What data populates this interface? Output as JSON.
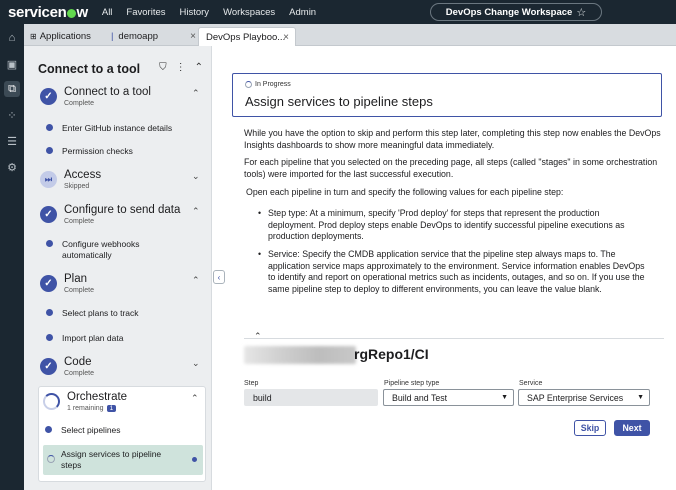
{
  "app": {
    "logo_text_1": "servicen",
    "logo_text_2": "w",
    "nav": [
      "All",
      "Favorites",
      "History",
      "Workspaces",
      "Admin"
    ],
    "workspace_title": "DevOps Change Workspace"
  },
  "tabs": {
    "applications": "Applications",
    "demoapp": "demoapp",
    "playbook": "DevOps Playboo..."
  },
  "sidebar": {
    "title": "Connect to a tool",
    "steps": [
      {
        "title": "Connect to a tool",
        "status": "Complete",
        "subs": [
          "Enter GitHub instance details",
          "Permission checks"
        ]
      },
      {
        "title": "Access",
        "status": "Skipped"
      },
      {
        "title": "Configure to send data",
        "status": "Complete",
        "subs": [
          "Configure webhooks automatically"
        ]
      },
      {
        "title": "Plan",
        "status": "Complete",
        "subs": [
          "Select plans to track",
          "Import plan data"
        ]
      },
      {
        "title": "Code",
        "status": "Complete"
      },
      {
        "title": "Orchestrate",
        "status": "1 remaining",
        "badge": "1",
        "subs": [
          "Select pipelines",
          "Assign services to pipeline steps"
        ]
      }
    ]
  },
  "main": {
    "status": "In Progress",
    "title": "Assign services to pipeline steps",
    "para1": "While you have the option to skip and perform this step later, completing this step now enables the DevOps Insights dashboards to show more meaningful data immediately.",
    "para2": "For each pipeline that you selected on the preceding page, all steps (called \"stages\" in some orchestration tools) were imported for the last successful execution.",
    "para3": "Open each pipeline in turn and specify the following values for each pipeline step:",
    "bullet1": "Step type: At a minimum, specify 'Prod deploy' for steps that represent the production deployment. Prod deploy steps enable DevOps to identify successful pipeline executions as production deployments.",
    "bullet2": "Service: Specify the CMDB application service that the pipeline step always maps to. The application service maps approximately to the environment. Service information enables DevOps to identify and report on operational metrics such as incidents, outages, and so on. If you use the same pipeline step to deploy to different environments, you can leave the value blank.",
    "repo_name_visible": "rgRepo1/CI",
    "fields": {
      "step_label": "Step",
      "step_value": "build",
      "type_label": "Pipeline step type",
      "type_value": "Build and Test",
      "service_label": "Service",
      "service_value": "SAP Enterprise Services"
    },
    "skip_label": "Skip",
    "next_label": "Next"
  },
  "colors": {
    "primary": "#3f53a6",
    "topbar": "#1b2731",
    "current_step_bg": "#cfe3dc"
  }
}
